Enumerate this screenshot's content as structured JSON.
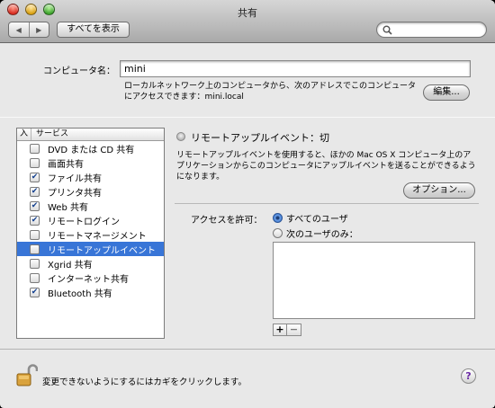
{
  "window": {
    "title": "共有"
  },
  "toolbar": {
    "back_glyph": "◀",
    "forward_glyph": "▶",
    "show_all_label": "すべてを表示",
    "search_value": ""
  },
  "computer": {
    "label": "コンピュータ名：",
    "name_value": "mini",
    "description": "ローカルネットワーク上のコンピュータから、次のアドレスでこのコンピュータにアクセスできます：mini.local",
    "edit_label": "編集..."
  },
  "services": {
    "header_on": "入",
    "header_service": "サービス",
    "items": [
      {
        "label": "DVD または CD 共有",
        "checked": false
      },
      {
        "label": "画面共有",
        "checked": false
      },
      {
        "label": "ファイル共有",
        "checked": true
      },
      {
        "label": "プリンタ共有",
        "checked": true
      },
      {
        "label": "Web 共有",
        "checked": true
      },
      {
        "label": "リモートログイン",
        "checked": true
      },
      {
        "label": "リモートマネージメント",
        "checked": false
      },
      {
        "label": "リモートアップルイベント",
        "checked": false,
        "selected": true
      },
      {
        "label": "Xgrid 共有",
        "checked": false
      },
      {
        "label": "インターネット共有",
        "checked": false
      },
      {
        "label": "Bluetooth 共有",
        "checked": true
      }
    ]
  },
  "detail": {
    "status": "リモートアップルイベント：切",
    "description": "リモートアップルイベントを使用すると、ほかの Mac OS X コンピュータ上のアプリケーションからこのコンピュータにアップルイベントを送ることができるようになります。",
    "options_label": "オプション...",
    "allow_label": "アクセスを許可：",
    "radio_all": "すべてのユーザ",
    "radio_only": "次のユーザのみ：",
    "add_label": "+",
    "remove_label": "−"
  },
  "footer": {
    "lock_text": "変更できないようにするにはカギをクリックします。",
    "help_label": "?"
  },
  "colors": {
    "selection": "#3875d7",
    "window_bg": "#e8e8e8"
  }
}
